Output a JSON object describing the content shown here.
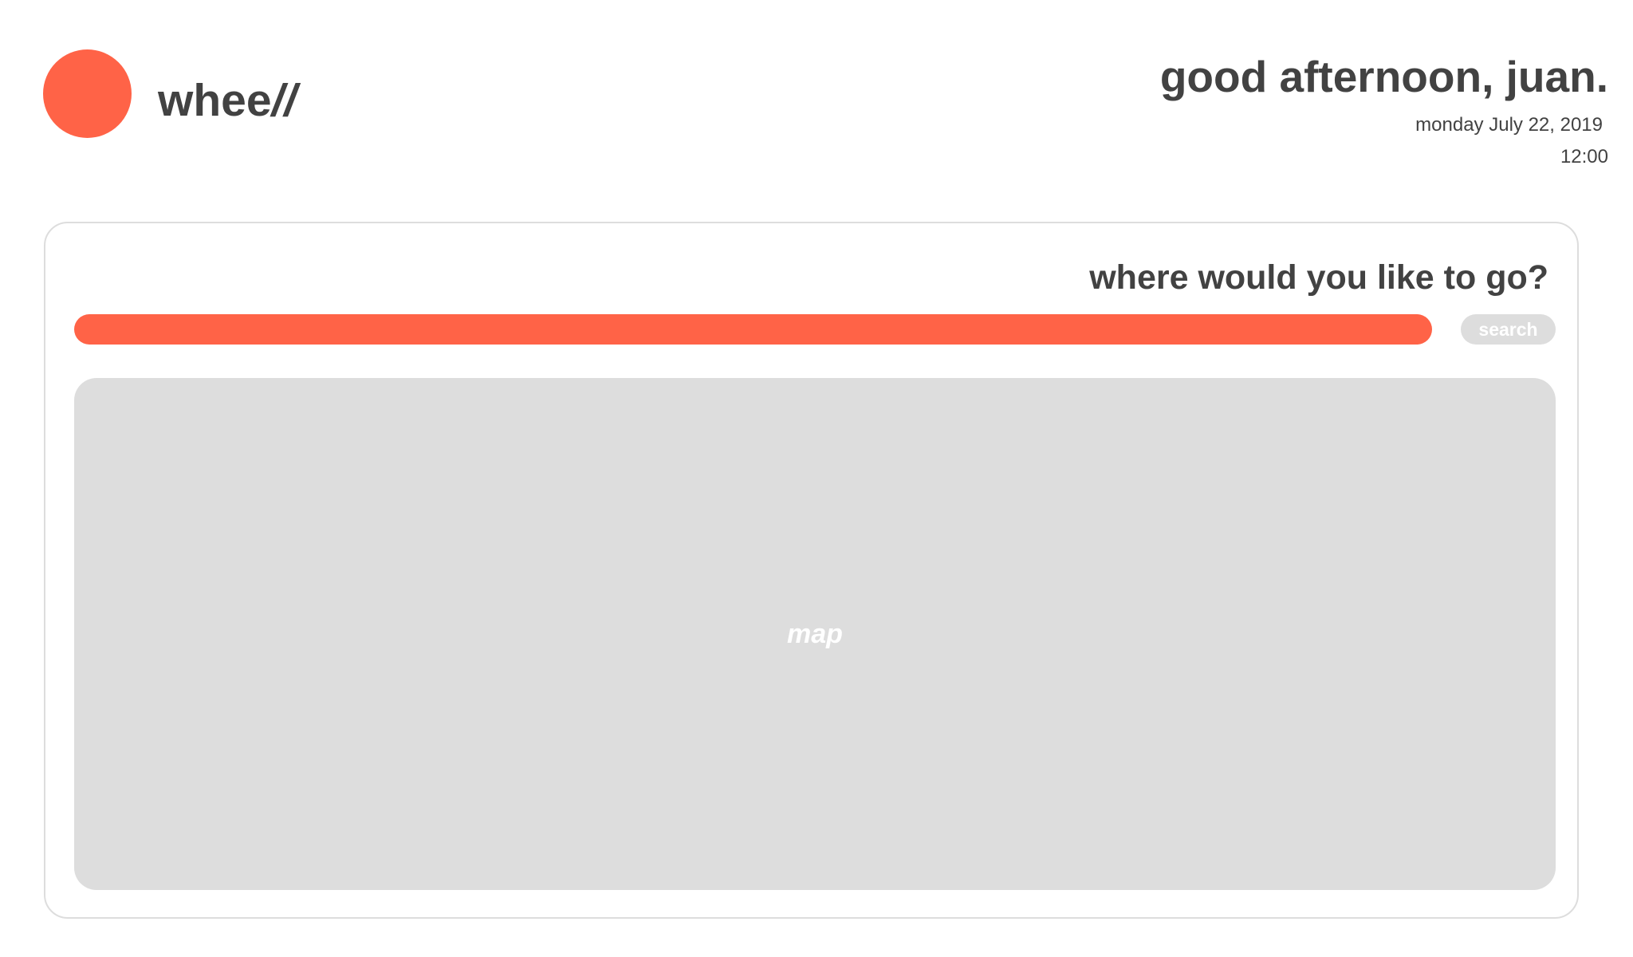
{
  "brand": {
    "name_prefix": "whee",
    "name_suffix": "//",
    "logo_color": "#ff6347"
  },
  "header": {
    "greeting": "good afternoon, juan.",
    "date": "monday July 22, 2019",
    "time": "12:00"
  },
  "destination": {
    "question": "where would you like to go?",
    "search_input_value": "",
    "search_button_label": "search",
    "input_color": "#ff6347"
  },
  "map": {
    "label": "map"
  }
}
